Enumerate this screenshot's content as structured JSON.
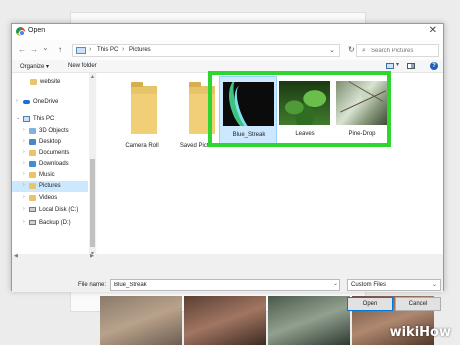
{
  "window": {
    "title": "Open",
    "close_glyph": "✕"
  },
  "nav": {
    "back": "←",
    "forward": "→",
    "recent": "⌄",
    "up": "↑",
    "path": [
      "This PC",
      "Pictures"
    ],
    "path_sep": "›",
    "refresh": "↻",
    "search_placeholder": "Search Pictures"
  },
  "command_bar": {
    "organize": "Organize ▾",
    "new_folder": "New folder",
    "view_dd": "▾",
    "help": "?"
  },
  "sidebar": {
    "items": [
      {
        "label": "website",
        "icon": "folder-icon"
      },
      {
        "label": "OneDrive",
        "icon": "cloud-icon"
      },
      {
        "label": "This PC",
        "icon": "pc-icon"
      },
      {
        "label": "3D Objects",
        "icon": "folder-icon"
      },
      {
        "label": "Desktop",
        "icon": "folder-icon"
      },
      {
        "label": "Documents",
        "icon": "folder-icon"
      },
      {
        "label": "Downloads",
        "icon": "folder-icon"
      },
      {
        "label": "Music",
        "icon": "folder-icon"
      },
      {
        "label": "Pictures",
        "icon": "folder-icon",
        "selected": true
      },
      {
        "label": "Videos",
        "icon": "folder-icon"
      },
      {
        "label": "Local Disk (C:)",
        "icon": "drive-icon"
      },
      {
        "label": "Backup (D:)",
        "icon": "drive-icon"
      }
    ]
  },
  "files": {
    "folders": [
      "Camera Roll",
      "Saved Pictures"
    ],
    "images": [
      {
        "name": "Blue_Streak",
        "selected": true
      },
      {
        "name": "Leaves"
      },
      {
        "name": "Pine-Drop"
      }
    ]
  },
  "bottom": {
    "file_name_label": "File name:",
    "file_name_value": "Blue_Streak",
    "file_type": "Custom Files",
    "open": "Open",
    "cancel": "Cancel"
  },
  "watermark": {
    "wiki": "wiki",
    "how": "How"
  },
  "colors": {
    "highlight": "#2fd62f",
    "selected_bg": "#cce8ff",
    "accent": "#0078d7"
  }
}
